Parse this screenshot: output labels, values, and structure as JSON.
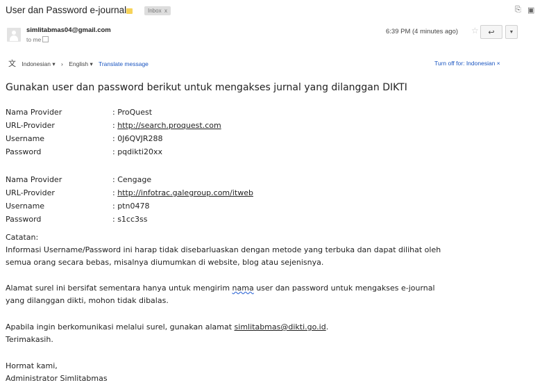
{
  "header": {
    "subject": "User dan Password e-journal",
    "inbox_label": "Inbox",
    "inbox_close": "x"
  },
  "message": {
    "sender": "simlitabmas04@gmail.com",
    "to": "to me",
    "time": "6:39 PM (4 minutes ago)"
  },
  "translate": {
    "from": "Indonesian ▾",
    "arrow": "›",
    "to": "English ▾",
    "link": "Translate message",
    "off": "Turn off for: Indonesian ×"
  },
  "body": {
    "heading": "Gunakan user dan password berikut untuk mengakses jurnal yang dilanggan DIKTI",
    "providers": [
      {
        "k_provider": "Nama Provider",
        "v_provider": ": ProQuest",
        "k_url": "URL-Provider",
        "v_url_prefix": ": ",
        "v_url": "http://search.proquest.com",
        "k_user": "Username",
        "v_user": ": 0J6QVJR288",
        "k_pass": "Password",
        "v_pass": ": pqdikti20xx"
      },
      {
        "k_provider": "Nama Provider",
        "v_provider": ": Cengage",
        "k_url": "URL-Provider",
        "v_url_prefix": ": ",
        "v_url": "http://infotrac.galegroup.com/itweb",
        "k_user": "Username",
        "v_user": ": ptn0478",
        "k_pass": "Password",
        "v_pass": ": s1cc3ss"
      }
    ],
    "catatan": "Catatan:",
    "note1_line1": "Informasi Username/Password ini harap tidak disebarluaskan dengan metode yang terbuka dan dapat dilihat oleh",
    "note1_line2": "semua orang secara bebas, misalnya diumumkan di website, blog atau sejenisnya.",
    "note2_line1_a": "Alamat surel ini bersifat sementara hanya untuk mengirim ",
    "note2_line1_b": "nama",
    "note2_line1_c": " user dan password untuk mengakses e-journal",
    "note2_line2": "yang dilanggan dikti, mohon tidak dibalas.",
    "note3_a": "Apabila ingin berkomunikasi melalui surel, gunakan alamat ",
    "note3_email": "simlitabmas@dikti.go.id",
    "note3_b": ".",
    "thanks": "Terimakasih.",
    "regards": "Hormat kami,",
    "signature": "Administrator Simlitabmas"
  }
}
